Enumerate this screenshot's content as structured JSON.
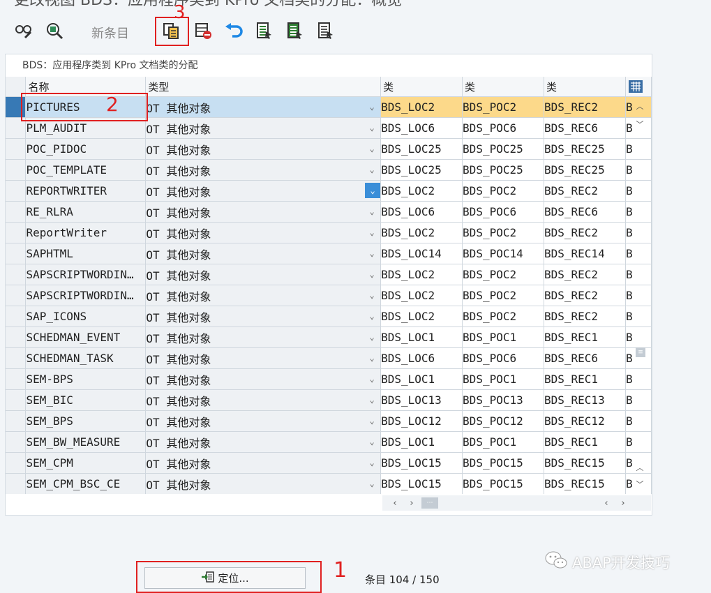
{
  "window": {
    "title": "更改视图 BDS：应用程序类到 KPro 文档类的分配：概览"
  },
  "toolbar": {
    "new_entries_label": "新条目",
    "icons": [
      "glasses-edit-icon",
      "display-change-icon",
      "copy-as-icon",
      "delete-icon",
      "undo-icon",
      "select-all-icon",
      "select-block-icon",
      "deselect-all-icon"
    ]
  },
  "panel": {
    "title": "BDS：应用程序类到 KPro 文档类的分配"
  },
  "grid": {
    "headers": {
      "name": "名称",
      "type": "类型",
      "class1": "类",
      "class2": "类",
      "class3": "类"
    },
    "rows": [
      {
        "name": "PICTURES",
        "type": "OT 其他对象",
        "c1": "BDS_LOC2",
        "c2": "BDS_POC2",
        "c3": "BDS_REC2",
        "c4": "B"
      },
      {
        "name": "PLM_AUDIT",
        "type": "OT 其他对象",
        "c1": "BDS_LOC6",
        "c2": "BDS_POC6",
        "c3": "BDS_REC6",
        "c4": "B"
      },
      {
        "name": "POC_PIDOC",
        "type": "OT 其他对象",
        "c1": "BDS_LOC25",
        "c2": "BDS_POC25",
        "c3": "BDS_REC25",
        "c4": "B"
      },
      {
        "name": "POC_TEMPLATE",
        "type": "OT 其他对象",
        "c1": "BDS_LOC25",
        "c2": "BDS_POC25",
        "c3": "BDS_REC25",
        "c4": "B"
      },
      {
        "name": "REPORTWRITER",
        "type": "OT 其他对象",
        "c1": "BDS_LOC2",
        "c2": "BDS_POC2",
        "c3": "BDS_REC2",
        "c4": "B"
      },
      {
        "name": "RE_RLRA",
        "type": "OT 其他对象",
        "c1": "BDS_LOC6",
        "c2": "BDS_POC6",
        "c3": "BDS_REC6",
        "c4": "B"
      },
      {
        "name": "ReportWriter",
        "type": "OT 其他对象",
        "c1": "BDS_LOC2",
        "c2": "BDS_POC2",
        "c3": "BDS_REC2",
        "c4": "B"
      },
      {
        "name": "SAPHTML",
        "type": "OT 其他对象",
        "c1": "BDS_LOC14",
        "c2": "BDS_POC14",
        "c3": "BDS_REC14",
        "c4": "B"
      },
      {
        "name": "SAPSCRIPTWORDIN…",
        "type": "OT 其他对象",
        "c1": "BDS_LOC2",
        "c2": "BDS_POC2",
        "c3": "BDS_REC2",
        "c4": "B"
      },
      {
        "name": "SAPSCRIPTWORDIN…",
        "type": "OT 其他对象",
        "c1": "BDS_LOC2",
        "c2": "BDS_POC2",
        "c3": "BDS_REC2",
        "c4": "B"
      },
      {
        "name": "SAP_ICONS",
        "type": "OT 其他对象",
        "c1": "BDS_LOC2",
        "c2": "BDS_POC2",
        "c3": "BDS_REC2",
        "c4": "B"
      },
      {
        "name": "SCHEDMAN_EVENT",
        "type": "OT 其他对象",
        "c1": "BDS_LOC1",
        "c2": "BDS_POC1",
        "c3": "BDS_REC1",
        "c4": "B"
      },
      {
        "name": "SCHEDMAN_TASK",
        "type": "OT 其他对象",
        "c1": "BDS_LOC6",
        "c2": "BDS_POC6",
        "c3": "BDS_REC6",
        "c4": "B"
      },
      {
        "name": "SEM-BPS",
        "type": "OT 其他对象",
        "c1": "BDS_LOC1",
        "c2": "BDS_POC1",
        "c3": "BDS_REC1",
        "c4": "B"
      },
      {
        "name": "SEM_BIC",
        "type": "OT 其他对象",
        "c1": "BDS_LOC13",
        "c2": "BDS_POC13",
        "c3": "BDS_REC13",
        "c4": "B"
      },
      {
        "name": "SEM_BPS",
        "type": "OT 其他对象",
        "c1": "BDS_LOC12",
        "c2": "BDS_POC12",
        "c3": "BDS_REC12",
        "c4": "B"
      },
      {
        "name": "SEM_BW_MEASURE",
        "type": "OT 其他对象",
        "c1": "BDS_LOC1",
        "c2": "BDS_POC1",
        "c3": "BDS_REC1",
        "c4": "B"
      },
      {
        "name": "SEM_CPM",
        "type": "OT 其他对象",
        "c1": "BDS_LOC15",
        "c2": "BDS_POC15",
        "c3": "BDS_REC15",
        "c4": "B"
      },
      {
        "name": "SEM_CPM_BSC_CE",
        "type": "OT 其他对象",
        "c1": "BDS_LOC15",
        "c2": "BDS_POC15",
        "c3": "BDS_REC15",
        "c4": "B"
      }
    ]
  },
  "footer": {
    "position_button_label": "定位...",
    "entry_label": "条目 104 / 150"
  },
  "annotations": {
    "one": "1",
    "two": "2",
    "three": "3"
  },
  "watermark": {
    "text": "ABAP开发技巧"
  },
  "colors": {
    "annotation_red": "#e02020",
    "row_highlight_blue": "#c7dff2",
    "row_highlight_gold": "#fcd98a",
    "active_dropdown": "#3a8ed8"
  }
}
